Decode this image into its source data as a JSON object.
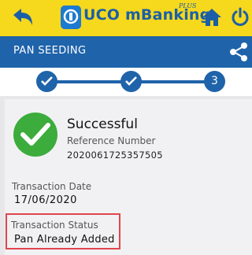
{
  "header": {
    "app_title": "UCO mBanking",
    "app_title_superscript": "PLUS",
    "back_icon": "back-arrow-icon",
    "home_icon": "home-icon",
    "power_icon": "power-icon",
    "background_color": "#f6d81c"
  },
  "titlebar": {
    "title": "PAN SEEDING",
    "share_icon": "share-icon",
    "background_color": "#1f63aa"
  },
  "stepper": {
    "steps": [
      {
        "state": "completed",
        "label": ""
      },
      {
        "state": "completed",
        "label": ""
      },
      {
        "state": "current",
        "label": "3"
      }
    ]
  },
  "result": {
    "status_title": "Successful",
    "reference_label": "Reference Number",
    "reference_value": "2020061725357505",
    "date_label": "Transaction Date",
    "date_value": "17/06/2020",
    "status_label": "Transaction Status",
    "status_value": "Pan Already Added",
    "success_color": "#3cac3c",
    "highlight_color": "#e0454f"
  }
}
